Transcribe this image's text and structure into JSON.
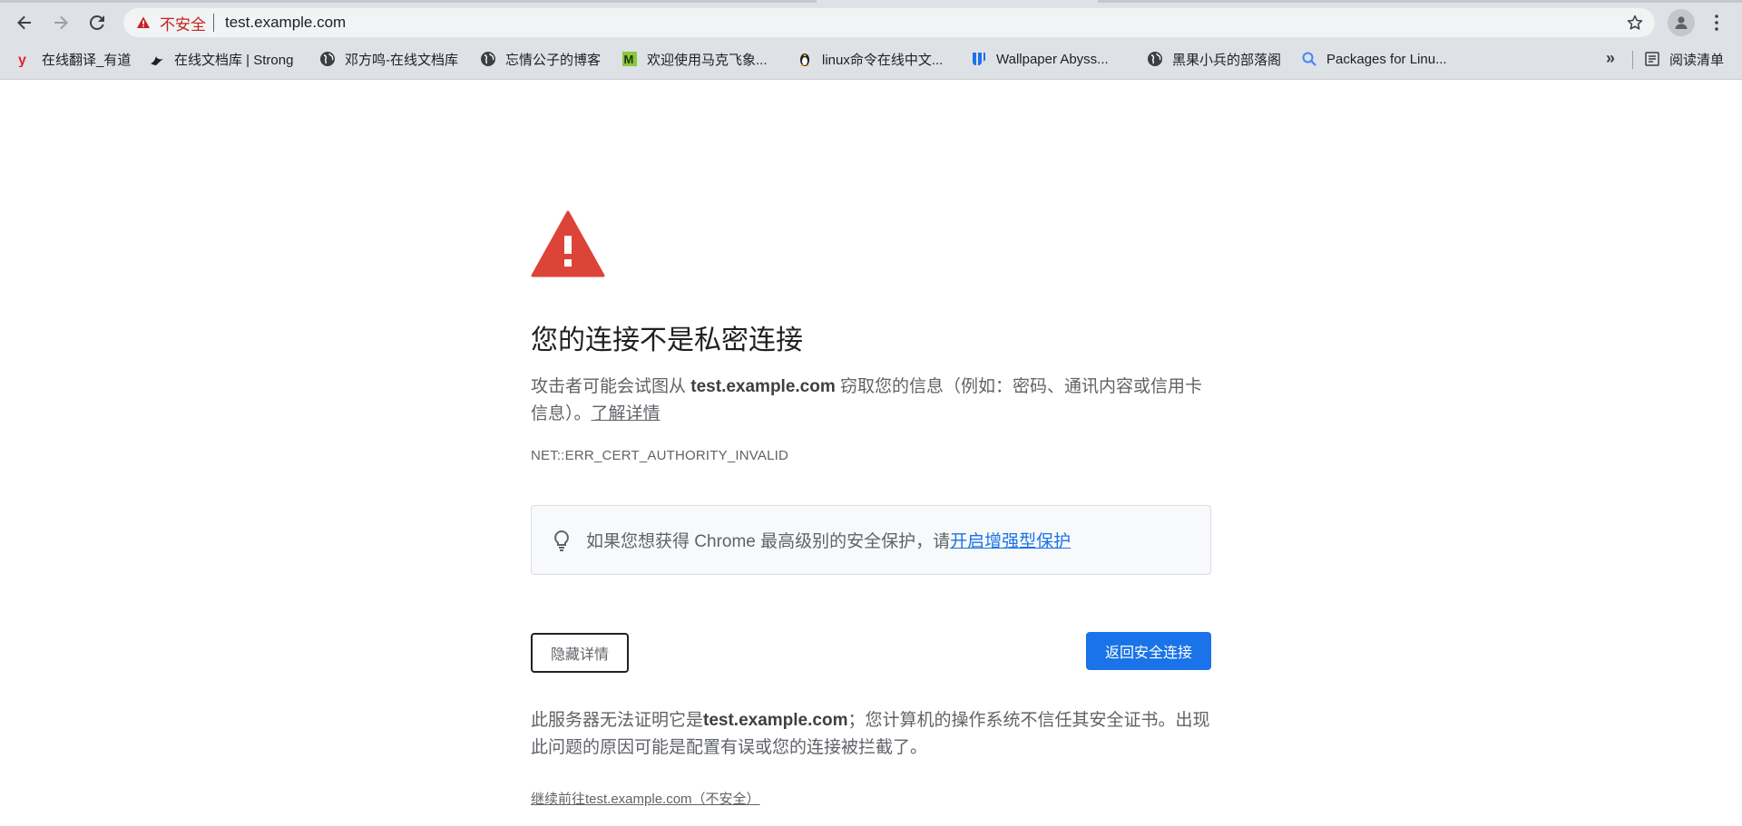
{
  "browser": {
    "omnibox": {
      "insecure_label": "不安全",
      "url": "test.example.com"
    },
    "bookmarks": [
      {
        "label": "在线翻译_有道",
        "icon": "youdao-icon"
      },
      {
        "label": "在线文档库 | Strong",
        "icon": "bird-icon"
      },
      {
        "label": "邓方鸣-在线文档库",
        "icon": "globe-icon"
      },
      {
        "label": "忘情公子的博客",
        "icon": "globe-icon"
      },
      {
        "label": "欢迎使用马克飞象...",
        "icon": "maxiang-icon"
      },
      {
        "label": "linux命令在线中文...",
        "icon": "penguin-icon"
      },
      {
        "label": "Wallpaper Abyss...",
        "icon": "wallpaper-icon"
      },
      {
        "label": "黑果小兵的部落阁",
        "icon": "globe-icon"
      },
      {
        "label": "Packages for Linu...",
        "icon": "search-icon"
      }
    ],
    "overflow_label": "»",
    "reading_list_label": "阅读清单",
    "colors": {
      "accent": "#1a73e8",
      "danger": "#d93025"
    }
  },
  "interstitial": {
    "heading": "您的连接不是私密连接",
    "para_pre": "攻击者可能会试图从 ",
    "para_host": "test.example.com",
    "para_post": " 窃取您的信息（例如：密码、通讯内容或信用卡信息）。",
    "learn_more": "了解详情",
    "error_code": "NET::ERR_CERT_AUTHORITY_INVALID",
    "enhanced_text": "如果您想获得 Chrome 最高级别的安全保护，请",
    "enhanced_link": "开启增强型保护",
    "hide_details_button": "隐藏详情",
    "back_button": "返回安全连接",
    "details_pre": "此服务器无法证明它是",
    "details_host": "test.example.com",
    "details_post": "；您计算机的操作系统不信任其安全证书。出现此问题的原因可能是配置有误或您的连接被拦截了。",
    "proceed_link": "继续前往test.example.com（不安全）"
  }
}
